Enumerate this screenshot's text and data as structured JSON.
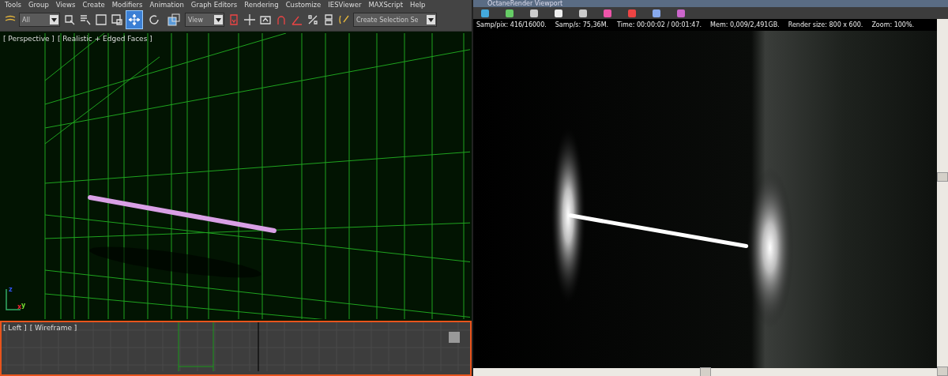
{
  "menu_bar": [
    "Tools",
    "Group",
    "Views",
    "Create",
    "Modifiers",
    "Animation",
    "Graph Editors",
    "Rendering",
    "Customize",
    "IESViewer",
    "MAXScript",
    "Help"
  ],
  "toolbar": {
    "selection_filter": "All",
    "coordinate_system": "View",
    "selection_set": "Create Selection Se",
    "transform_tools": [
      {
        "kind": "move",
        "selected": true
      },
      {
        "kind": "rotate",
        "selected": false
      },
      {
        "kind": "scale",
        "selected": false
      }
    ]
  },
  "perspective_viewport": {
    "labels": [
      "[ Perspective ]",
      "[ Realistic + Edged Faces ]"
    ],
    "active": false,
    "axes": [
      "z",
      "x",
      "y"
    ]
  },
  "left_viewport": {
    "labels": [
      "[ Left ]",
      "[ Wireframe ]"
    ],
    "active": true
  },
  "render_window": {
    "title": "OctaneRender Viewport",
    "stats": [
      "Samp/pix: 416/16000.",
      "Samp/s: 75,36M.",
      "Time: 00:00:02 / 00:01:47.",
      "Mem: 0,009/2,491GB.",
      "Render size: 800 x 600.",
      "Zoom: 100%."
    ]
  }
}
